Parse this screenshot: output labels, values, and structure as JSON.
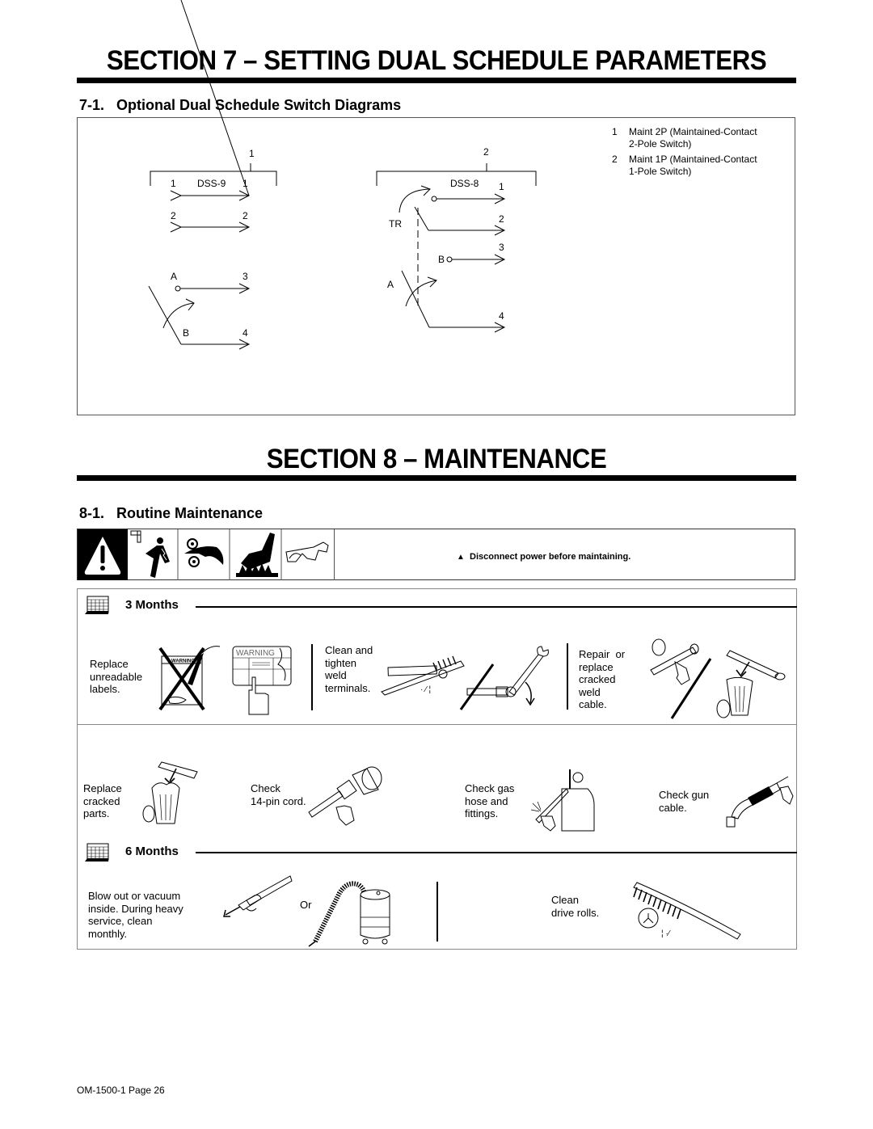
{
  "section7": {
    "title": "SECTION 7 – SETTING DUAL SCHEDULE PARAMETERS",
    "subsection": {
      "number": "7-1.",
      "title": "Optional Dual Schedule Switch Diagrams"
    },
    "legend": [
      {
        "num": "1",
        "line1": "Maint 2P (Maintained-Contact",
        "line2": "2-Pole Switch)"
      },
      {
        "num": "2",
        "line1": "Maint 1P (Maintained-Contact",
        "line2": "1-Pole Switch)"
      }
    ],
    "diagram_dss9": {
      "callout": "1",
      "name": "DSS-9",
      "left_labels": [
        "1",
        "2",
        "A",
        "B"
      ],
      "right_labels": [
        "1",
        "2",
        "3",
        "4"
      ]
    },
    "diagram_dss8": {
      "callout": "2",
      "name": "DSS-8",
      "tr_label": "TR",
      "a_label": "A",
      "b_label": "B",
      "right_labels": [
        "1",
        "2",
        "3",
        "4"
      ]
    }
  },
  "section8": {
    "title": "SECTION 8 – MAINTENANCE",
    "subsection": {
      "number": "8-1.",
      "title": "Routine Maintenance"
    },
    "warning_text": "Disconnect power before maintaining.",
    "safety_icons": [
      "warning-triangle-icon",
      "electric-shock-icon",
      "moving-parts-icon",
      "hot-parts-icon",
      "safety-glasses-icon"
    ],
    "three_months": {
      "heading": "3 Months",
      "tasks_row1": [
        {
          "text": "Replace\nunreadable\nlabels.",
          "sign_text": "WARNING",
          "label_text": "WARNING"
        },
        {
          "text": "Clean and\ntighten\nweld\nterminals."
        },
        {
          "text": "Repair  or\nreplace\ncracked\nweld\ncable."
        }
      ],
      "tasks_row2": [
        {
          "text": "Replace\ncracked\nparts."
        },
        {
          "text": "Check\n14-pin cord."
        },
        {
          "text": "Check gas\nhose and\nfittings."
        },
        {
          "text": "Check gun\ncable."
        }
      ]
    },
    "six_months": {
      "heading": "6 Months",
      "tasks": [
        {
          "text": "Blow out or vacuum\ninside. During heavy\nservice, clean\nmonthly.",
          "or_label": "Or"
        },
        {
          "text": "Clean\ndrive rolls."
        }
      ]
    }
  },
  "footer": {
    "page_label": "OM-1500-1 Page 26"
  }
}
